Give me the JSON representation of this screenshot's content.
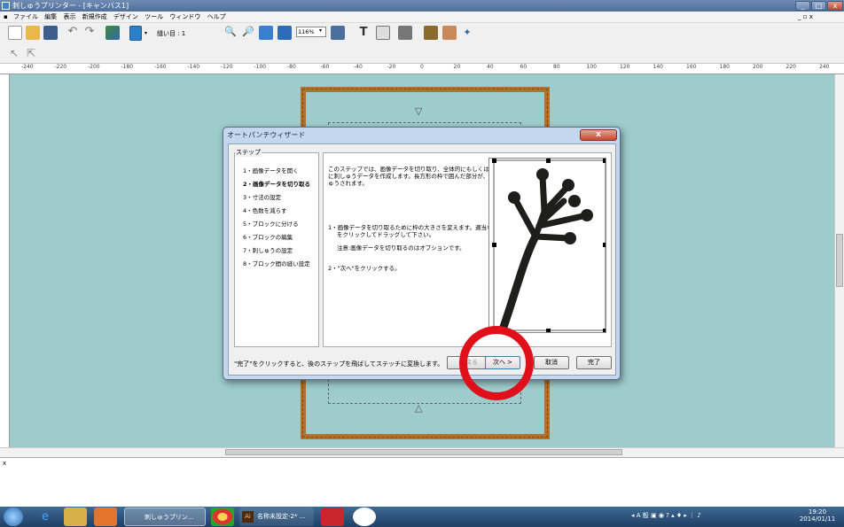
{
  "window": {
    "title": "刺しゅうプリンター - [キャンバス1]"
  },
  "menu": [
    "ファイル",
    "編集",
    "表示",
    "新規作成",
    "デザイン",
    "ツール",
    "ウィンドウ",
    "ヘルプ"
  ],
  "toolbar": {
    "stitch_label": "縫い目 : 1",
    "zoom_value": "116%"
  },
  "ruler_ticks": [
    "-240",
    "-220",
    "-200",
    "-180",
    "-160",
    "-140",
    "-120",
    "-100",
    "-80",
    "-60",
    "-40",
    "-20",
    "0",
    "20",
    "40",
    "60",
    "80",
    "100",
    "120",
    "140",
    "160",
    "180",
    "200",
    "220",
    "240"
  ],
  "dialog": {
    "title": "オートパンチウィザード",
    "close": "x",
    "steps_label": "ステップ",
    "steps": [
      "1・画像データを開く",
      "2・画像データを切り取る",
      "3・寸法の設定",
      "4・色数を減らす",
      "5・ブロックに分ける",
      "6・ブロックの編集",
      "7・刺しゅうの設定",
      "8・ブロック間の縫い設定"
    ],
    "active_step": 1,
    "description": [
      "このステップでは、画像データを切り取り、全体的にもしくは部分的",
      "に刺しゅうデータを作成します。長方形の枠で囲んだ部分が、刺し",
      "ゅうされます。"
    ],
    "instruction1": [
      "1・画像データを切り取るために枠の大きさを変えます。適当な■",
      "をクリックしてドラッグして下さい。"
    ],
    "note": "注意:画像データを切り取るのはオプションです。",
    "instruction2": "2・\"次へ\"をクリックする。",
    "footer_note": "\"完了\"をクリックすると、後のステップを飛ばしてステッチに変換します。",
    "buttons": {
      "back": "< 戻る",
      "next": "次へ >",
      "cancel": "取消",
      "finish": "完了"
    }
  },
  "taskbar": {
    "items": [
      "刺しゅうプリン...",
      "名称未設定-2* ..."
    ],
    "time": "19:20",
    "date": "2014/01/11"
  },
  "colors": {
    "canvas": "#9ecbcb",
    "hoop": "#b5712a",
    "highlight": "#e0101b"
  }
}
